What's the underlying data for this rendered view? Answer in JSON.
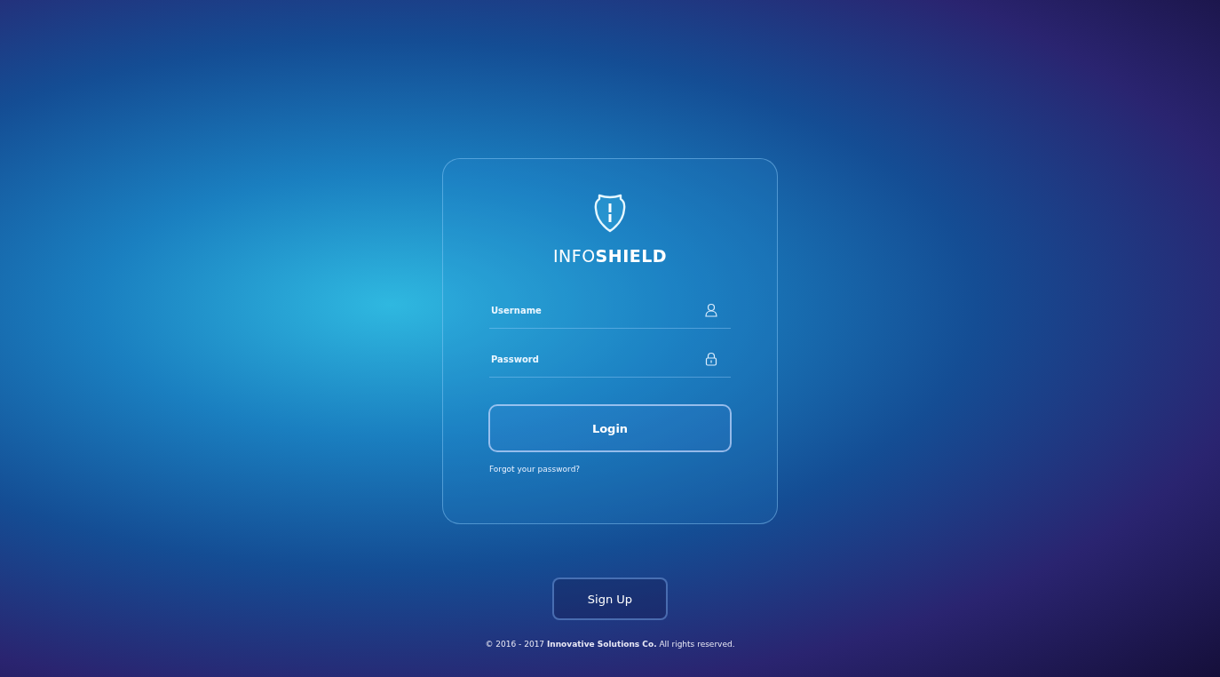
{
  "logo": {
    "text": "INFO**SHIELD**"
  },
  "fields": [
    {
      "kind": "username",
      "placeholder": "Username"
    },
    {
      "kind": "password",
      "placeholder": "Password"
    }
  ],
  "login_button": "Login",
  "forgot_link": "Forgot your password?",
  "signup_button": "Sign Up",
  "footer": "© 2016 - 2017 **Innovative Solutions Co.** All rights reserved."
}
